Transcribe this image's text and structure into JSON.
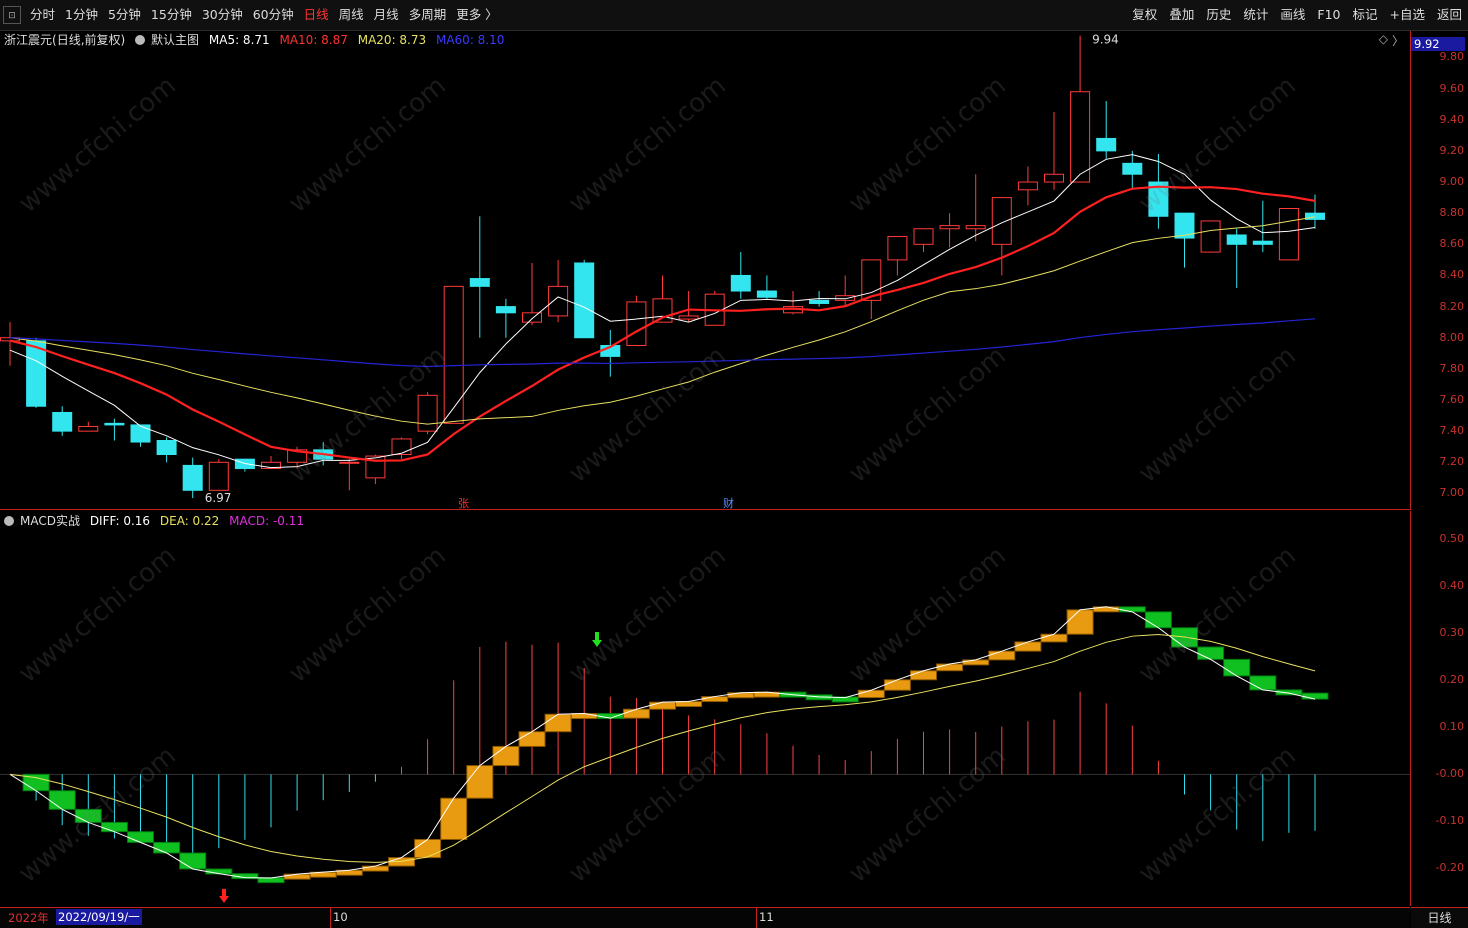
{
  "toolbar": {
    "corner_icon": "collapse-icon",
    "periods": [
      "分时",
      "1分钟",
      "5分钟",
      "15分钟",
      "30分钟",
      "60分钟",
      "日线",
      "周线",
      "月线",
      "多周期",
      "更多 〉"
    ],
    "active_period": "日线",
    "right_items": [
      "复权",
      "叠加",
      "历史",
      "统计",
      "画线",
      "F10",
      "标记",
      "+自选",
      "返回"
    ]
  },
  "main_legend": {
    "stock_name": "浙江震元",
    "mode": "(日线,前复权)",
    "template": "默认主图",
    "ma5": "MA5: 8.71",
    "ma10": "MA10: 8.87",
    "ma20": "MA20: 8.73",
    "ma60": "MA60: 8.10"
  },
  "macd_legend": {
    "name": "MACD实战",
    "diff": "DIFF: 0.16",
    "dea": "DEA: 0.22",
    "macd": "MACD: -0.11"
  },
  "current_price_tag": "9.92",
  "main_axis_ticks": [
    "9.80",
    "9.60",
    "9.40",
    "9.20",
    "9.00",
    "8.80",
    "8.60",
    "8.40",
    "8.20",
    "8.00",
    "7.80",
    "7.60",
    "7.40",
    "7.20",
    "7.00"
  ],
  "macd_axis_ticks": [
    "0.50",
    "0.40",
    "0.30",
    "0.20",
    "0.10",
    "-0.00",
    "-0.10",
    "-0.20"
  ],
  "annotations": {
    "high": "9.94",
    "low": "6.97",
    "mark_zhang": "张",
    "mark_cai": "财"
  },
  "date_bar": {
    "year": "2022年",
    "cursor_date": "2022/09/19/一",
    "month_10": "10",
    "month_11": "11"
  },
  "bottom_right": "日线",
  "watermark": "www.cfchi.com",
  "colors": {
    "up": "#ff3a3a",
    "down": "#33e5ee",
    "ma5": "#ffffff",
    "ma10": "#ff2020",
    "ma20": "#e8e060",
    "ma60": "#2424d8"
  },
  "chart_data": {
    "type": "candlestick",
    "ohlc": [
      [
        7.98,
        8.1,
        7.82,
        8.0
      ],
      [
        7.98,
        8.0,
        7.55,
        7.56
      ],
      [
        7.52,
        7.56,
        7.37,
        7.4
      ],
      [
        7.4,
        7.46,
        7.4,
        7.43
      ],
      [
        7.45,
        7.48,
        7.34,
        7.44
      ],
      [
        7.44,
        7.44,
        7.3,
        7.33
      ],
      [
        7.34,
        7.36,
        7.2,
        7.25
      ],
      [
        7.18,
        7.23,
        6.97,
        7.02
      ],
      [
        7.02,
        7.22,
        7.02,
        7.2
      ],
      [
        7.22,
        7.22,
        7.14,
        7.16
      ],
      [
        7.16,
        7.24,
        7.16,
        7.2
      ],
      [
        7.2,
        7.3,
        7.16,
        7.28
      ],
      [
        7.28,
        7.33,
        7.18,
        7.22
      ],
      [
        7.2,
        7.22,
        7.02,
        7.2
      ],
      [
        7.1,
        7.25,
        7.06,
        7.24
      ],
      [
        7.25,
        7.36,
        7.22,
        7.35
      ],
      [
        7.4,
        7.65,
        7.38,
        7.63
      ],
      [
        7.45,
        8.33,
        7.45,
        8.33
      ],
      [
        8.38,
        8.78,
        8.0,
        8.33
      ],
      [
        8.2,
        8.25,
        8.0,
        8.16
      ],
      [
        8.1,
        8.48,
        8.08,
        8.16
      ],
      [
        8.14,
        8.5,
        8.1,
        8.33
      ],
      [
        8.48,
        8.5,
        8.0,
        8.0
      ],
      [
        7.95,
        8.05,
        7.75,
        7.88
      ],
      [
        7.95,
        8.27,
        7.95,
        8.23
      ],
      [
        8.1,
        8.4,
        8.1,
        8.25
      ],
      [
        8.12,
        8.3,
        8.1,
        8.14
      ],
      [
        8.08,
        8.3,
        8.08,
        8.28
      ],
      [
        8.4,
        8.55,
        8.25,
        8.3
      ],
      [
        8.3,
        8.4,
        8.25,
        8.26
      ],
      [
        8.16,
        8.3,
        8.15,
        8.2
      ],
      [
        8.24,
        8.3,
        8.2,
        8.22
      ],
      [
        8.24,
        8.4,
        8.2,
        8.27
      ],
      [
        8.24,
        8.4,
        8.12,
        8.5
      ],
      [
        8.5,
        8.65,
        8.4,
        8.65
      ],
      [
        8.6,
        8.7,
        8.55,
        8.7
      ],
      [
        8.7,
        8.8,
        8.58,
        8.72
      ],
      [
        8.7,
        9.05,
        8.62,
        8.72
      ],
      [
        8.6,
        8.82,
        8.4,
        8.9
      ],
      [
        8.95,
        9.1,
        8.85,
        9.0
      ],
      [
        9.0,
        9.45,
        8.95,
        9.05
      ],
      [
        9.0,
        9.94,
        9.0,
        9.58
      ],
      [
        9.28,
        9.52,
        9.15,
        9.2
      ],
      [
        9.12,
        9.2,
        8.95,
        9.05
      ],
      [
        9.0,
        9.18,
        8.7,
        8.78
      ],
      [
        8.8,
        8.8,
        8.45,
        8.64
      ],
      [
        8.55,
        8.75,
        8.55,
        8.75
      ],
      [
        8.66,
        8.7,
        8.32,
        8.6
      ],
      [
        8.62,
        8.88,
        8.55,
        8.6
      ],
      [
        8.5,
        8.83,
        8.5,
        8.83
      ],
      [
        8.8,
        8.92,
        8.7,
        8.76
      ]
    ],
    "macd_diff_last": 0.16,
    "macd_dea_last": 0.22,
    "macd_hist_last": -0.11,
    "main_ylim": [
      6.9,
      9.97
    ],
    "macd_ylim": [
      -0.28,
      0.56
    ]
  }
}
